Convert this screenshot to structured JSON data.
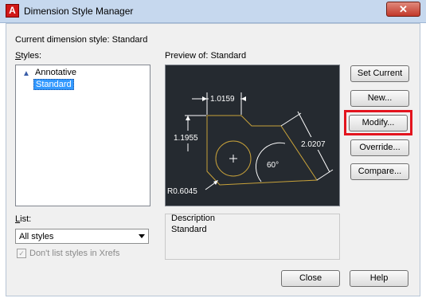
{
  "window": {
    "title": "Dimension Style Manager",
    "app_icon_letter": "A",
    "close_glyph": "✕"
  },
  "current_style": {
    "label": "Current dimension style: Standard"
  },
  "styles": {
    "label": "Styles:",
    "items": [
      {
        "label": "Annotative",
        "icon": "annotative-icon"
      },
      {
        "label": "Standard",
        "selected": true
      }
    ]
  },
  "preview": {
    "label": "Preview of: Standard",
    "dims": {
      "top": "1.0159",
      "left": "1.1955",
      "right": "2.0207",
      "angle": "60°",
      "radius": "R0.6045"
    }
  },
  "buttons": {
    "set_current": "Set Current",
    "new": "New...",
    "modify": "Modify...",
    "override": "Override...",
    "compare": "Compare...",
    "close": "Close",
    "help": "Help"
  },
  "list": {
    "label": "List:",
    "value": "All styles"
  },
  "xrefs_checkbox": {
    "label": "Don't list styles in Xrefs",
    "checked": true
  },
  "description": {
    "label": "Description",
    "value": "Standard"
  },
  "colors": {
    "preview_bg": "#252a30",
    "geometry": "#c8a23a",
    "highlight": "#e3141e",
    "selection": "#3399ff"
  }
}
